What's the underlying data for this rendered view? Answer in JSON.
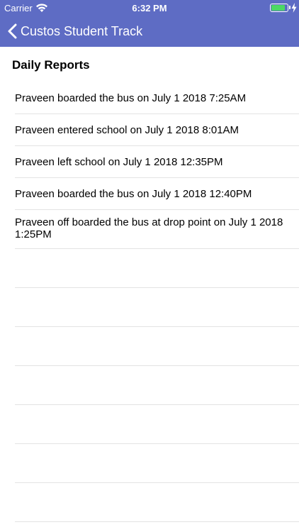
{
  "status_bar": {
    "carrier": "Carrier",
    "time": "6:32 PM",
    "battery_level": 0.85,
    "charging": true
  },
  "nav": {
    "back_icon": "chevron-left-icon",
    "title": "Custos Student Track"
  },
  "section": {
    "title": "Daily Reports"
  },
  "reports": [
    "Praveen boarded the bus on July 1 2018 7:25AM",
    "Praveen entered school on July 1 2018 8:01AM",
    "Praveen left school on July 1 2018 12:35PM",
    "Praveen boarded the bus on July 1 2018 12:40PM",
    "Praveen off boarded the bus at drop point on July 1 2018 1:25PM"
  ],
  "colors": {
    "header": "#5e6cc4",
    "separator": "#e3e3e3",
    "battery": "#4cd964"
  }
}
